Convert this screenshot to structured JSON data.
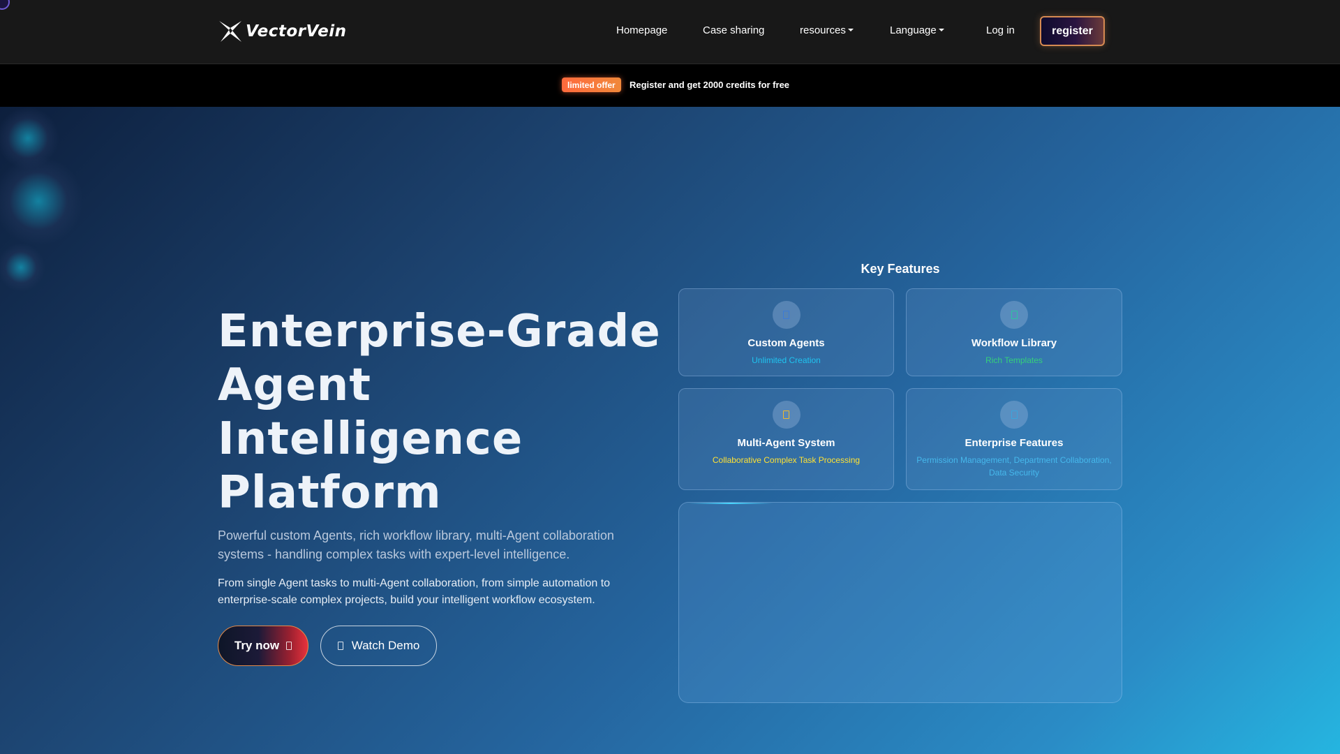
{
  "nav": {
    "logo_text": "VectorVein",
    "items": [
      {
        "label": "Homepage"
      },
      {
        "label": "Case sharing"
      },
      {
        "label": "resources"
      },
      {
        "label": "Language"
      },
      {
        "label": "Log in"
      }
    ],
    "register_label": "register"
  },
  "promo": {
    "badge": "limited offer",
    "text": "Register and get 2000 credits for free"
  },
  "hero": {
    "title_lines": [
      "Enterprise-Grade",
      "Agent",
      "Intelligence",
      "Platform"
    ],
    "subtitle": "Powerful custom Agents, rich workflow library, multi-Agent collaboration systems - handling complex tasks with expert-level intelligence.",
    "description": "From single Agent tasks to multi-Agent collaboration, from simple automation to enterprise-scale complex projects, build your intelligent workflow ecosystem.",
    "try_label": "Try now",
    "demo_label": "Watch Demo"
  },
  "features": {
    "title": "Key Features",
    "cards": [
      {
        "title": "Custom Agents",
        "subtitle": "Unlimited Creation",
        "icon": "agent-icon",
        "color": "#1fc4f0"
      },
      {
        "title": "Workflow Library",
        "subtitle": "Rich Templates",
        "icon": "workflow-icon",
        "color": "#35d17a"
      },
      {
        "title": "Multi-Agent System",
        "subtitle": "Collaborative Complex Task Processing",
        "icon": "multi-agent-icon",
        "color": "#ffe234"
      },
      {
        "title": "Enterprise Features",
        "subtitle": "Permission Management, Department Collaboration, Data Security",
        "icon": "enterprise-icon",
        "color": "#46b8ec"
      }
    ]
  },
  "colors": {
    "accent_orange": "#ff6a3d",
    "register_border": "#d68a52",
    "try_button_red": "#e8323c"
  }
}
